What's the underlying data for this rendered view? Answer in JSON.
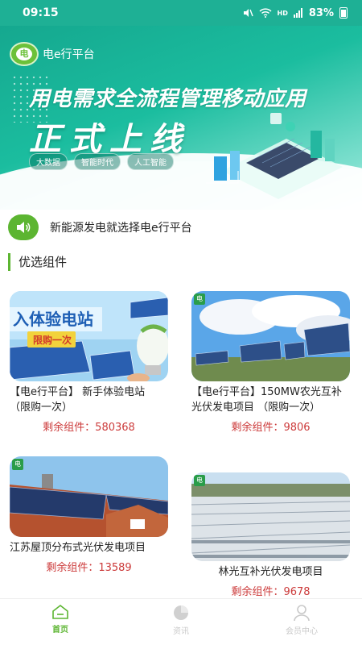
{
  "status_bar": {
    "time": "09:15",
    "network": "HD",
    "battery": "83%"
  },
  "banner": {
    "brand": "电e行平台",
    "logo_text": "电",
    "title": "用电需求全流程管理移动应用",
    "subtitle": "正式上线",
    "tags": [
      "大数据",
      "智能时代",
      "人工智能"
    ]
  },
  "notice": {
    "text": "新能源发电就选择电e行平台"
  },
  "section": {
    "title": "优选组件"
  },
  "cards": [
    {
      "name": "【电e行平台】 新手体验电站 （限购一次）",
      "remain": "剩余组件：580368",
      "banner_text": "入体验电站",
      "badge": "限购一次"
    },
    {
      "name": "【电e行平台】150MW农光互补光伏发电项目 （限购一次）",
      "remain": "剩余组件：9806",
      "logo_text": "电"
    },
    {
      "name": "江苏屋顶分布式光伏发电项目",
      "remain": "剩余组件：13589",
      "logo_text": "电"
    },
    {
      "name": "林光互补光伏发电项目",
      "remain": "剩余组件：9678",
      "logo_text": "电"
    }
  ],
  "tabbar": [
    {
      "label": "首页",
      "icon": "home-icon",
      "active": true
    },
    {
      "label": "资讯",
      "icon": "pie-chart-icon",
      "active": false
    },
    {
      "label": "会员中心",
      "icon": "user-icon",
      "active": false
    }
  ],
  "colors": {
    "teal": "#1eb095",
    "green": "#5cb531",
    "red": "#cc3b3b"
  }
}
